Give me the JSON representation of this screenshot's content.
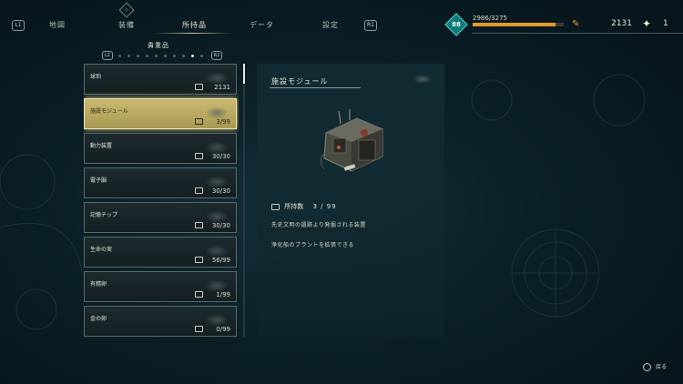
{
  "nav": {
    "left_hint": "L1",
    "right_hint": "R1",
    "top_hint": "◇",
    "tabs": [
      {
        "label": "地図"
      },
      {
        "label": "装備"
      },
      {
        "label": "所持品"
      },
      {
        "label": "データ"
      },
      {
        "label": "設定"
      }
    ],
    "active_tab": "所持品"
  },
  "status": {
    "level": "88",
    "exp_text": "2986/3275",
    "exp_fraction": 0.91,
    "currency": "2131",
    "special_count": "1",
    "accent_color": "#e39a2a"
  },
  "category": {
    "title": "貴重品",
    "left_cap": "L2",
    "right_cap": "R2",
    "page_count": 10,
    "active_page": 9
  },
  "items": [
    {
      "name": "球珀",
      "qty": "2131"
    },
    {
      "name": "施設モジュール",
      "qty": "3/99"
    },
    {
      "name": "動力装置",
      "qty": "30/30"
    },
    {
      "name": "電子脳",
      "qty": "30/30"
    },
    {
      "name": "記憶チップ",
      "qty": "30/30"
    },
    {
      "name": "生命の実",
      "qty": "56/99"
    },
    {
      "name": "有精卵",
      "qty": "1/99"
    },
    {
      "name": "金の卵",
      "qty": "0/99"
    }
  ],
  "selected_index": 1,
  "detail": {
    "title": "施設モジュール",
    "owned_label": "所持数",
    "owned_value": "3 / 99",
    "desc1": "先史文明の遺跡より発掘される装置",
    "desc2": "浄化船のプラントを拡張できる"
  },
  "back": {
    "label": "戻る",
    "icon": "circle-button-icon"
  }
}
